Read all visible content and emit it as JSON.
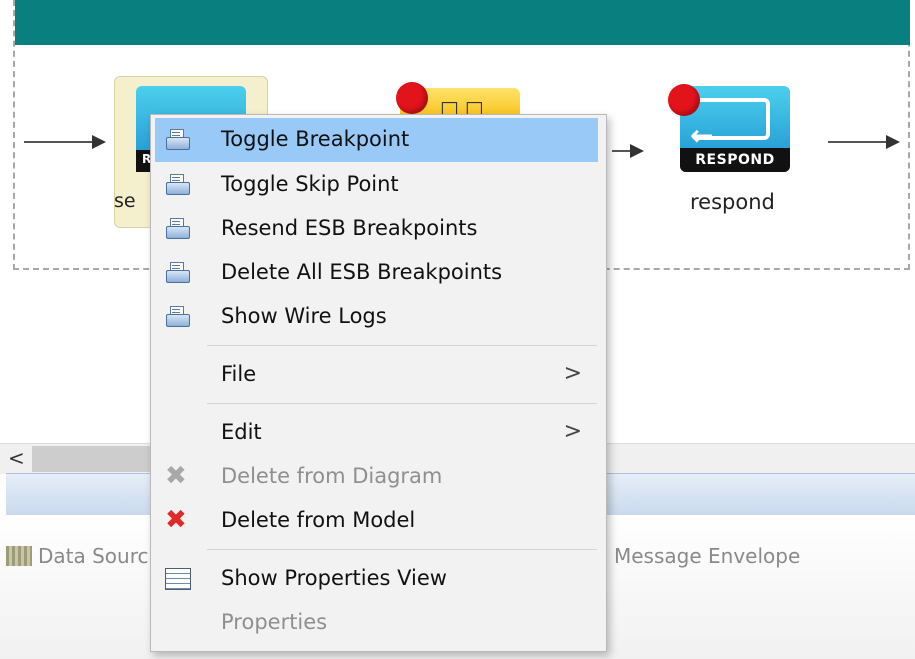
{
  "diagram": {
    "send_label_partial": "se",
    "send_strip_partial": "R",
    "mid_glyph": "□□",
    "respond_strip": "RESPOND",
    "respond_label": "respond"
  },
  "scrollbar": {
    "left_arrow": "<"
  },
  "bottom_tabs": {
    "data_source": "Data Sourc",
    "message_envelope": "Message Envelope"
  },
  "context_menu": {
    "toggle_breakpoint": "Toggle Breakpoint",
    "toggle_skip_point": "Toggle Skip Point",
    "resend_esb_breakpoints": "Resend ESB Breakpoints",
    "delete_all_esb_breakpoints": "Delete All ESB Breakpoints",
    "show_wire_logs": "Show Wire Logs",
    "file": "File",
    "edit": "Edit",
    "delete_from_diagram": "Delete from Diagram",
    "delete_from_model": "Delete from Model",
    "show_properties_view": "Show Properties View",
    "properties": "Properties",
    "submenu_arrow": ">"
  }
}
